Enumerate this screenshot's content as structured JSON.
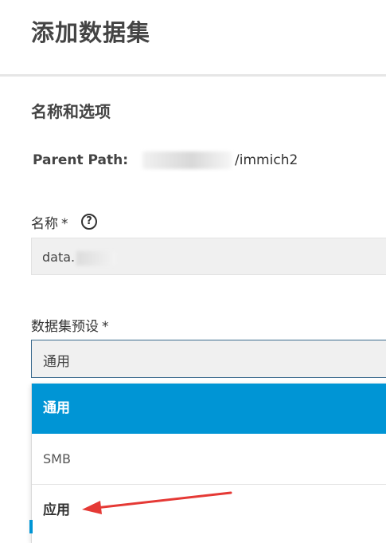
{
  "page": {
    "title": "添加数据集"
  },
  "section": {
    "title": "名称和选项"
  },
  "parent_path": {
    "label": "Parent Path:",
    "suffix": "/immich2"
  },
  "name_field": {
    "label": "名称",
    "required_mark": "*",
    "value": "data."
  },
  "preset_field": {
    "label": "数据集预设",
    "required_mark": "*",
    "selected": "通用",
    "options": [
      "通用",
      "SMB",
      "应用"
    ]
  },
  "colors": {
    "accent": "#0095d5",
    "arrow": "#e53935"
  },
  "icons": {
    "help": "help-icon",
    "annotation": "red-arrow-annotation"
  }
}
